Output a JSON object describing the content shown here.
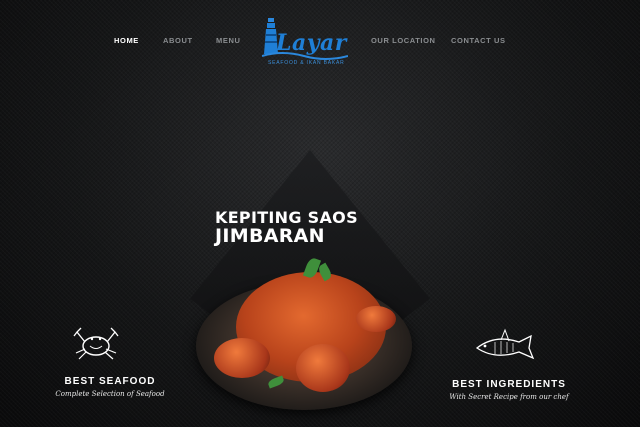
{
  "nav": {
    "items": [
      {
        "label": "HOME",
        "active": true
      },
      {
        "label": "ABOUT",
        "active": false
      },
      {
        "label": "MENU",
        "active": false
      },
      {
        "label": "OUR LOCATION",
        "active": false
      },
      {
        "label": "CONTACT US",
        "active": false
      }
    ]
  },
  "logo": {
    "name": "Layar",
    "tagline": "SEAFOOD & IKAN BAKAR",
    "color": "#1f7fd6"
  },
  "hero": {
    "title_line1": "KEPITING SAOS",
    "title_line2": "JIMBARAN"
  },
  "features": [
    {
      "title": "BEST SEAFOOD",
      "subtitle": "Complete Selection of Seafood",
      "icon": "crab-icon"
    },
    {
      "title": "BEST INGREDIENTS",
      "subtitle": "With Secret Recipe from our chef",
      "icon": "fish-icon"
    }
  ]
}
